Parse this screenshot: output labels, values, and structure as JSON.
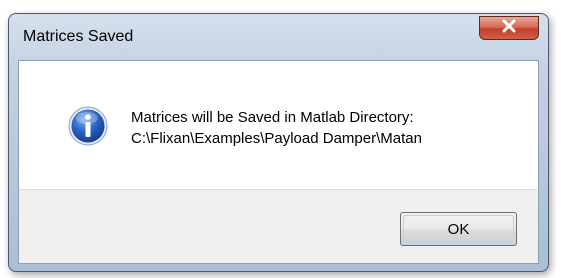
{
  "window": {
    "title": "Matrices Saved",
    "close_icon": "close-x-icon",
    "close_color": "#c84a34"
  },
  "message": {
    "icon": "information-icon",
    "icon_color": "#2a63c4",
    "line1": "Matrices will be Saved in Matlab Directory:",
    "line2": "C:\\Flixan\\Examples\\Payload Damper\\Matan"
  },
  "buttons": {
    "ok_label": "OK"
  }
}
